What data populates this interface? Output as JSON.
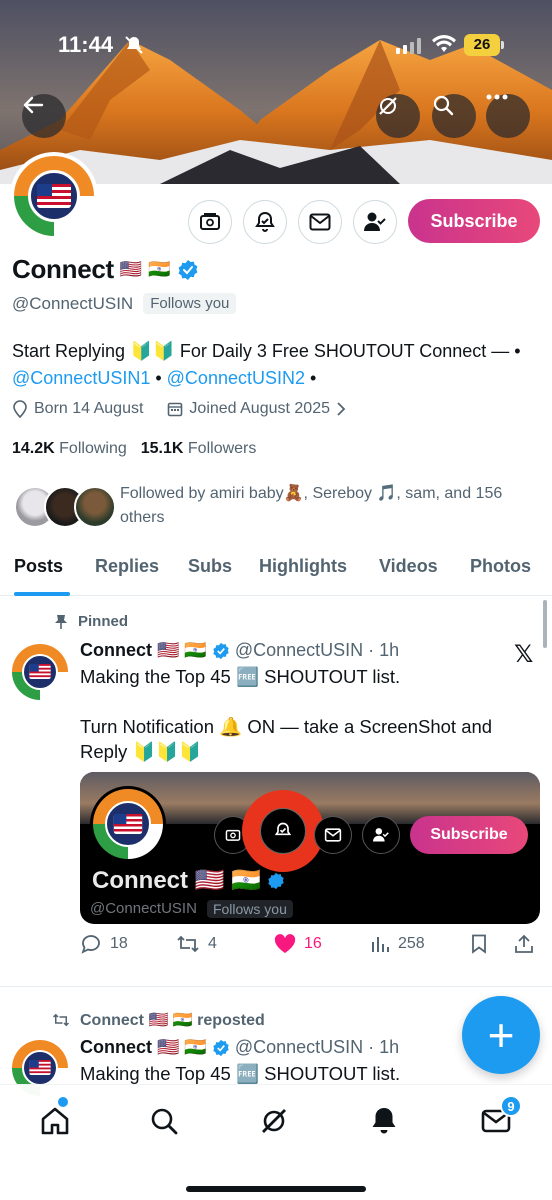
{
  "status_bar": {
    "time": "11:44",
    "battery": "26"
  },
  "profile": {
    "name": "Connect",
    "flags": [
      "🇺🇸",
      "🇮🇳"
    ],
    "handle": "@ConnectUSIN",
    "follows_you": "Follows you",
    "subscribe_label": "Subscribe",
    "bio_prefix": "Start Replying 🔰🔰 For Daily 3 Free SHOUTOUT Connect — • ",
    "bio_link1": "@ConnectUSIN1",
    "bio_mid": " • ",
    "bio_link2": "@ConnectUSIN2",
    "bio_suffix": " •",
    "born": "Born 14 August",
    "joined": "Joined August 2025",
    "following_count": "14.2K",
    "following_label": "Following",
    "followers_count": "15.1K",
    "followers_label": "Followers",
    "followed_by": "Followed by amiri baby🧸, Sereboy 🎵, sam, and 156 others"
  },
  "tabs": [
    "Posts",
    "Replies",
    "Subs",
    "Highlights",
    "Videos",
    "Photos"
  ],
  "post1": {
    "pinned_label": "Pinned",
    "name": "Connect 🇺🇸 🇮🇳",
    "handle_time": "@ConnectUSIN · 1h",
    "text_line1": "Making the Top 45 🆓 SHOUTOUT list.",
    "text_line2": "Turn Notification 🔔 ON — take a ScreenShot and Reply 🔰🔰🔰",
    "embed": {
      "name": "Connect 🇺🇸 🇮🇳",
      "handle": "@ConnectUSIN",
      "follows_you": "Follows you",
      "subscribe_label": "Subscribe"
    },
    "replies": "18",
    "reposts": "4",
    "likes": "16",
    "views": "258"
  },
  "post2": {
    "repost_label": "Connect 🇺🇸 🇮🇳 reposted",
    "name": "Connect 🇺🇸 🇮🇳",
    "handle_time": "@ConnectUSIN · 1h",
    "text_line1": "Making the Top 45 🆓 SHOUTOUT list."
  },
  "fab_label": "+",
  "nav": {
    "messages_badge": "9"
  },
  "colors": {
    "accent": "#1d9bf0",
    "like": "#f91880",
    "subscribe": "#d6407f"
  },
  "icons": [
    "back-arrow-icon",
    "grok-icon",
    "search-icon",
    "more-icon",
    "grok-icon",
    "bell-plus-icon",
    "mail-icon",
    "user-check-icon",
    "verified-badge-icon",
    "location-icon",
    "calendar-icon",
    "pin-icon",
    "x-logo-icon",
    "reply-icon",
    "repost-icon",
    "heart-icon",
    "views-icon",
    "bookmark-icon",
    "share-icon",
    "home-icon",
    "search-icon",
    "grok-icon",
    "bell-icon",
    "mail-icon"
  ]
}
